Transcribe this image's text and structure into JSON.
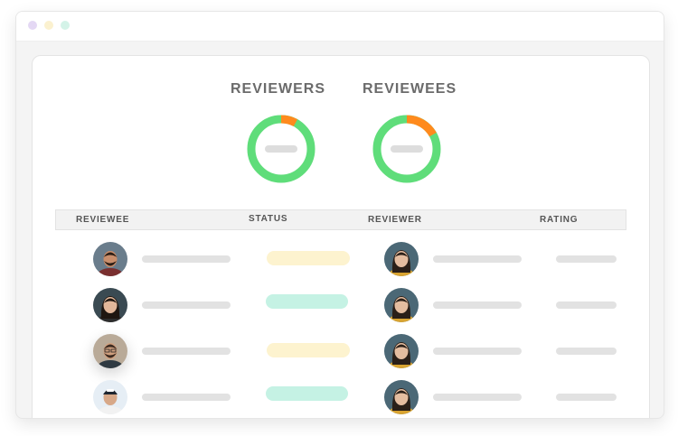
{
  "window": {
    "dots": [
      "#e4d8f4",
      "#fbf1cf",
      "#d4f3e8"
    ]
  },
  "stats": {
    "reviewers": {
      "title": "REVIEWERS",
      "progress": 0.08
    },
    "reviewees": {
      "title": "REVIEWEES",
      "progress": 0.17
    },
    "colors": {
      "ring": "#5fdd7a",
      "done": "#ff8a1d",
      "placeholder": "#dddddd"
    }
  },
  "table": {
    "columns": {
      "reviewee": "REVIEWEE",
      "status": "STATUS",
      "reviewer": "REVIEWER",
      "rating": "RATING"
    },
    "status_colors": {
      "pending": "#fdf3cf",
      "complete": "#c5f2e4"
    },
    "rows": [
      {
        "reviewee_avatar": "avatar-man-beard-icon",
        "status": "pending",
        "reviewer_avatar": "avatar-woman-icon"
      },
      {
        "reviewee_avatar": "avatar-woman-curly-icon",
        "status": "complete",
        "reviewer_avatar": "avatar-woman-icon"
      },
      {
        "reviewee_avatar": "avatar-man-glasses-icon",
        "status": "pending",
        "reviewer_avatar": "avatar-woman-icon"
      },
      {
        "reviewee_avatar": "avatar-man-cap-icon",
        "status": "complete",
        "reviewer_avatar": "avatar-woman-icon"
      }
    ]
  }
}
